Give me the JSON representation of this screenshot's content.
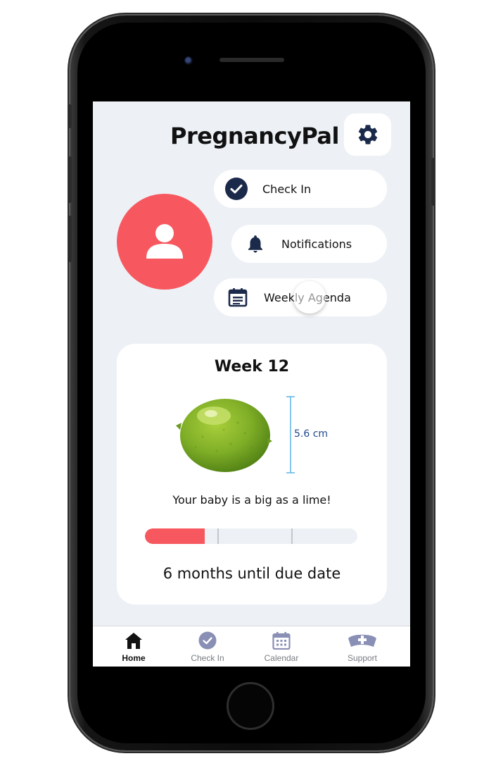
{
  "app": {
    "title": "PregnancyPal"
  },
  "actions": {
    "check_in": "Check In",
    "notifications": "Notifications",
    "weekly_agenda": "Weekly Agenda"
  },
  "week_card": {
    "title": "Week 12",
    "size_label": "5.6 cm",
    "comparison": "Your baby is a big as a lime!",
    "progress_fraction": 0.28,
    "due_text": "6 months until due date"
  },
  "tab_bar": {
    "home": "Home",
    "check_in": "Check In",
    "calendar": "Calendar",
    "support": "Support"
  },
  "icons": {
    "settings": "gear-icon",
    "profile": "person-icon",
    "check_in": "check-circle-icon",
    "notifications": "bell-icon",
    "agenda": "calendar-list-icon",
    "fruit": "lime-image",
    "tab_home": "home-icon",
    "tab_check_in": "check-circle-icon",
    "tab_calendar": "calendar-icon",
    "tab_support": "nurse-cap-icon"
  },
  "colors": {
    "accent": "#f7585f",
    "navy": "#1b2a4a",
    "tab_icon": "#8a8fb5",
    "background": "#edf1f6"
  }
}
